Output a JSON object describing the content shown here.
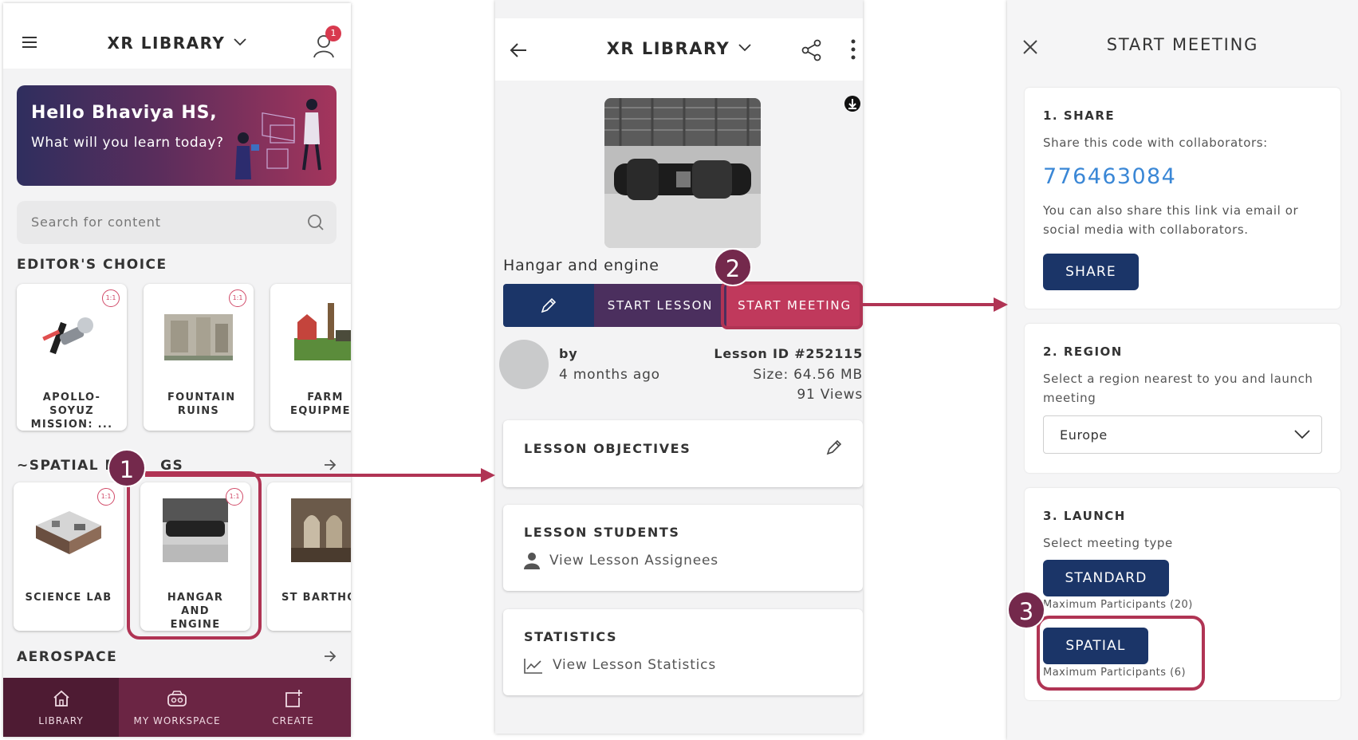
{
  "colors": {
    "brand_navy": "#1b3568",
    "brand_crimson": "#c0395c",
    "nav_bg": "#6b2544",
    "highlight": "#b03454",
    "link_blue": "#3a87d6"
  },
  "screen1": {
    "title": "XR LIBRARY",
    "notification_count": "1",
    "banner": {
      "greeting": "Hello Bhaviya HS,",
      "subtitle": "What will you learn today?"
    },
    "search_placeholder": "Search for content",
    "editors_choice": {
      "heading": "EDITOR'S CHOICE",
      "cards": [
        {
          "label": "APOLLO-SOYUZ MISSION: ...",
          "badge": "1:1"
        },
        {
          "label": "FOUNTAIN RUINS",
          "badge": "1:1"
        },
        {
          "label": "FARM EQUIPMEN"
        }
      ]
    },
    "spatial_meetings": {
      "heading_start": "~SPATIAL ME",
      "heading_end": "GS",
      "cards": [
        {
          "label": "SCIENCE LAB",
          "badge": "1:1"
        },
        {
          "label": "HANGAR AND ENGINE",
          "badge": "1:1"
        },
        {
          "label": "ST BARTHOLC"
        }
      ]
    },
    "aerospace_heading": "AEROSPACE",
    "nav": [
      {
        "label": "LIBRARY",
        "icon": "home-icon"
      },
      {
        "label": "MY WORKSPACE",
        "icon": "headset-icon"
      },
      {
        "label": "CREATE",
        "icon": "create-icon"
      }
    ]
  },
  "screen2": {
    "title": "XR LIBRARY",
    "lesson_title": "Hangar and engine",
    "buttons": {
      "start_lesson": "START LESSON",
      "start_meeting": "START MEETING"
    },
    "meta": {
      "by": "by",
      "age": "4 months ago",
      "lesson_id": "Lesson ID #252115",
      "size": "Size: 64.56 MB",
      "views": "91 Views"
    },
    "objectives": {
      "title": "LESSON OBJECTIVES"
    },
    "students": {
      "title": "LESSON STUDENTS",
      "link": "View Lesson Assignees"
    },
    "statistics": {
      "title": "STATISTICS",
      "link": "View Lesson Statistics"
    }
  },
  "screen3": {
    "title": "START MEETING",
    "share": {
      "heading": "1. SHARE",
      "instruction": "Share this code with collaborators:",
      "code": "776463084",
      "description_line1": "You can also share this link via email or",
      "description_line2": "social media with collaborators.",
      "button": "SHARE"
    },
    "region": {
      "heading": "2. REGION",
      "instruction_line1": "Select a region nearest to you and launch",
      "instruction_line2": "meeting",
      "selected": "Europe"
    },
    "launch": {
      "heading": "3. LAUNCH",
      "instruction": "Select meeting type",
      "standard_button": "STANDARD",
      "standard_note": "Maximum Participants (20)",
      "spatial_button": "SPATIAL",
      "spatial_note": "Maximum Participants (6)"
    }
  },
  "annotations": {
    "step1": "1",
    "step2": "2",
    "step3": "3"
  }
}
